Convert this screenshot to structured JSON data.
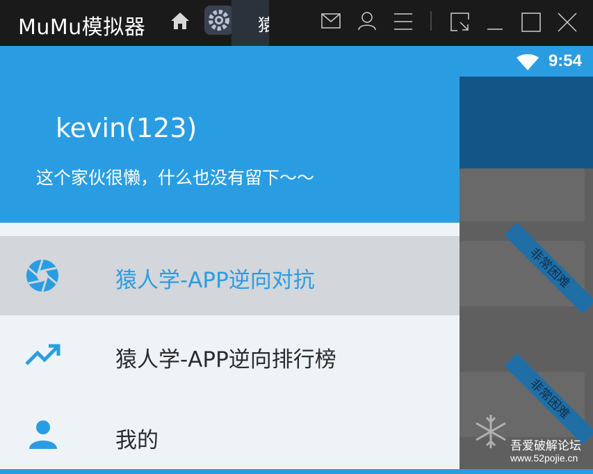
{
  "emulator": {
    "title": "MuMu模拟器",
    "active_tab_label": "猿人学"
  },
  "status": {
    "time": "9:54"
  },
  "drawer": {
    "user": {
      "name": "kevin(123)",
      "bio": "这个家伙很懒，什么也没有留下～～"
    },
    "items": [
      {
        "label": "猿人学-APP逆向对抗",
        "icon": "aperture-icon",
        "selected": true
      },
      {
        "label": "猿人学-APP逆向排行榜",
        "icon": "trending-up-icon",
        "selected": false
      },
      {
        "label": "我的",
        "icon": "person-icon",
        "selected": false
      }
    ]
  },
  "background_app": {
    "ribbon_text": "非常困难"
  },
  "watermark": {
    "site_name": "吾爱破解论坛",
    "url": "www.52pojie.cn"
  },
  "colors": {
    "accent": "#2a9de2",
    "titlebar": "#1a1a1a",
    "selected_row": "#d3d6da",
    "drawer_bg": "#eef3f8"
  }
}
